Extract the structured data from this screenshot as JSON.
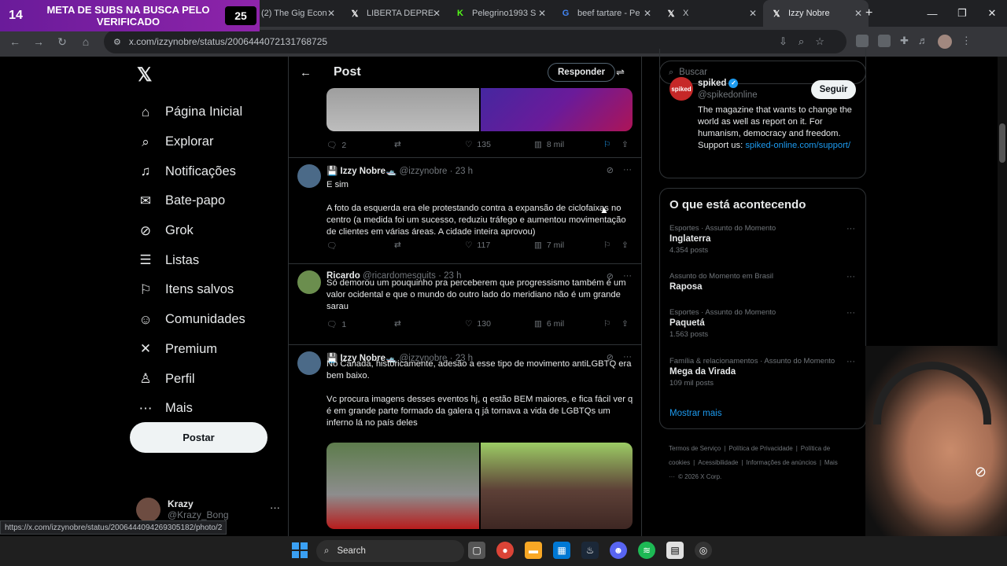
{
  "browser": {
    "tabs": [
      {
        "label": "(2) The Gig Econ",
        "icon": "youtube-icon",
        "color": "#ff0000"
      },
      {
        "label": "LIBERTA DEPRE",
        "icon": "x-icon",
        "color": "#ffffff"
      },
      {
        "label": "Pelegrino1993 S",
        "icon": "kick-icon",
        "color": "#53fc18"
      },
      {
        "label": "beef tartare - Pe",
        "icon": "google-icon",
        "color": "#4285f4"
      },
      {
        "label": "X",
        "icon": "x-icon",
        "color": "#ffffff"
      },
      {
        "label": "Izzy Nobre",
        "icon": "x-icon",
        "color": "#ffffff"
      }
    ],
    "url": "x.com/izzynobre/status/2006444072131768725",
    "status_url": "https://x.com/izzynobre/status/2006444094269305182/photo/2"
  },
  "overlay": {
    "left_num": "14",
    "text": "META DE SUBS NA BUSCA PELO VERIFICADO",
    "right_num": "25"
  },
  "nav": {
    "items": [
      {
        "label": "Página Inicial",
        "icon": "home-icon",
        "glyph": "⌂"
      },
      {
        "label": "Explorar",
        "icon": "search-icon",
        "glyph": "⌕"
      },
      {
        "label": "Notificações",
        "icon": "bell-icon",
        "glyph": "♫"
      },
      {
        "label": "Bate-papo",
        "icon": "mail-icon",
        "glyph": "✉"
      },
      {
        "label": "Grok",
        "icon": "grok-icon",
        "glyph": "⊘"
      },
      {
        "label": "Listas",
        "icon": "list-icon",
        "glyph": "☰"
      },
      {
        "label": "Itens salvos",
        "icon": "bookmark-icon",
        "glyph": "⚐"
      },
      {
        "label": "Comunidades",
        "icon": "communities-icon",
        "glyph": "☺"
      },
      {
        "label": "Premium",
        "icon": "x-premium-icon",
        "glyph": "✕"
      },
      {
        "label": "Perfil",
        "icon": "profile-icon",
        "glyph": "♙"
      },
      {
        "label": "Mais",
        "icon": "more-icon",
        "glyph": "⋯"
      }
    ],
    "post_button": "Postar",
    "account": {
      "name": "Krazy",
      "handle": "@Krazy_Bong"
    }
  },
  "post": {
    "header_title": "Post",
    "reply_button": "Responder",
    "first_actions": {
      "replies": "2",
      "likes": "135",
      "views": "8 mil"
    },
    "tweets": [
      {
        "name": "💾 Izzy Nobre🛥️",
        "handle": "@izzynobre",
        "time": "· 23 h",
        "avatar": "#4b6a88",
        "paragraphs": [
          "E sim",
          "A foto da esquerda era ele protestando contra a expansão de ciclofaixas no centro (a medida foi um sucesso, reduziu tráfego e aumentou movimentação de clientes em várias áreas. A cidade inteira aprovou)"
        ],
        "replies": "",
        "likes": "117",
        "views": "7 mil"
      },
      {
        "name": "Ricardo",
        "handle": "@ricardomesquits",
        "time": "· 23 h",
        "avatar": "#6b8e4e",
        "paragraphs": [
          "Só demorou um pouquinho pra perceberem que progressismo também é um valor ocidental e que o mundo do outro lado do meridiano não é um grande sarau"
        ],
        "replies": "1",
        "likes": "130",
        "views": "6 mil"
      },
      {
        "name": "💾 Izzy Nobre🛥️",
        "handle": "@izzynobre",
        "time": "· 23 h",
        "avatar": "#4b6a88",
        "paragraphs": [
          "No Canadá, historicamente, adesão a esse tipo de movimento antiLGBTQ era bem baixo.",
          "Vc procura imagens desses eventos hj, q estão BEM maiores, e fica fácil ver q é em grande parte formado da galera q já tornava a vida de LGBTQs um inferno lá no país deles"
        ],
        "replies": "",
        "likes": "",
        "views": ""
      }
    ]
  },
  "sidebar": {
    "search_placeholder": "Buscar",
    "follow_card": {
      "name": "spiked",
      "handle": "@spikedonline",
      "avatar_text": "spiked",
      "follow_label": "Seguir",
      "bio": "The magazine that wants to change the world as well as report on it. For humanism, democracy and freedom. Support us:",
      "link": "spiked-online.com/support/"
    },
    "trends_title": "O que está acontecendo",
    "trends": [
      {
        "category": "Esportes · Assunto do Momento",
        "name": "Inglaterra",
        "count": "4.354 posts"
      },
      {
        "category": "Assunto do Momento em Brasil",
        "name": "Raposa",
        "count": ""
      },
      {
        "category": "Esportes · Assunto do Momento",
        "name": "Paquetá",
        "count": "1.563 posts"
      },
      {
        "category": "Família & relacionamentos · Assunto do Momento",
        "name": "Mega da Virada",
        "count": "109 mil posts"
      }
    ],
    "show_more": "Mostrar mais",
    "footer": [
      "Termos de Serviço",
      "|",
      "Política de Privacidade",
      "|",
      "Política de cookies",
      "|",
      "Acessibilidade",
      "|",
      "Informações de anúncios",
      "|",
      "Mais ···",
      "© 2026 X Corp."
    ]
  },
  "taskbar": {
    "search_label": "Search"
  }
}
